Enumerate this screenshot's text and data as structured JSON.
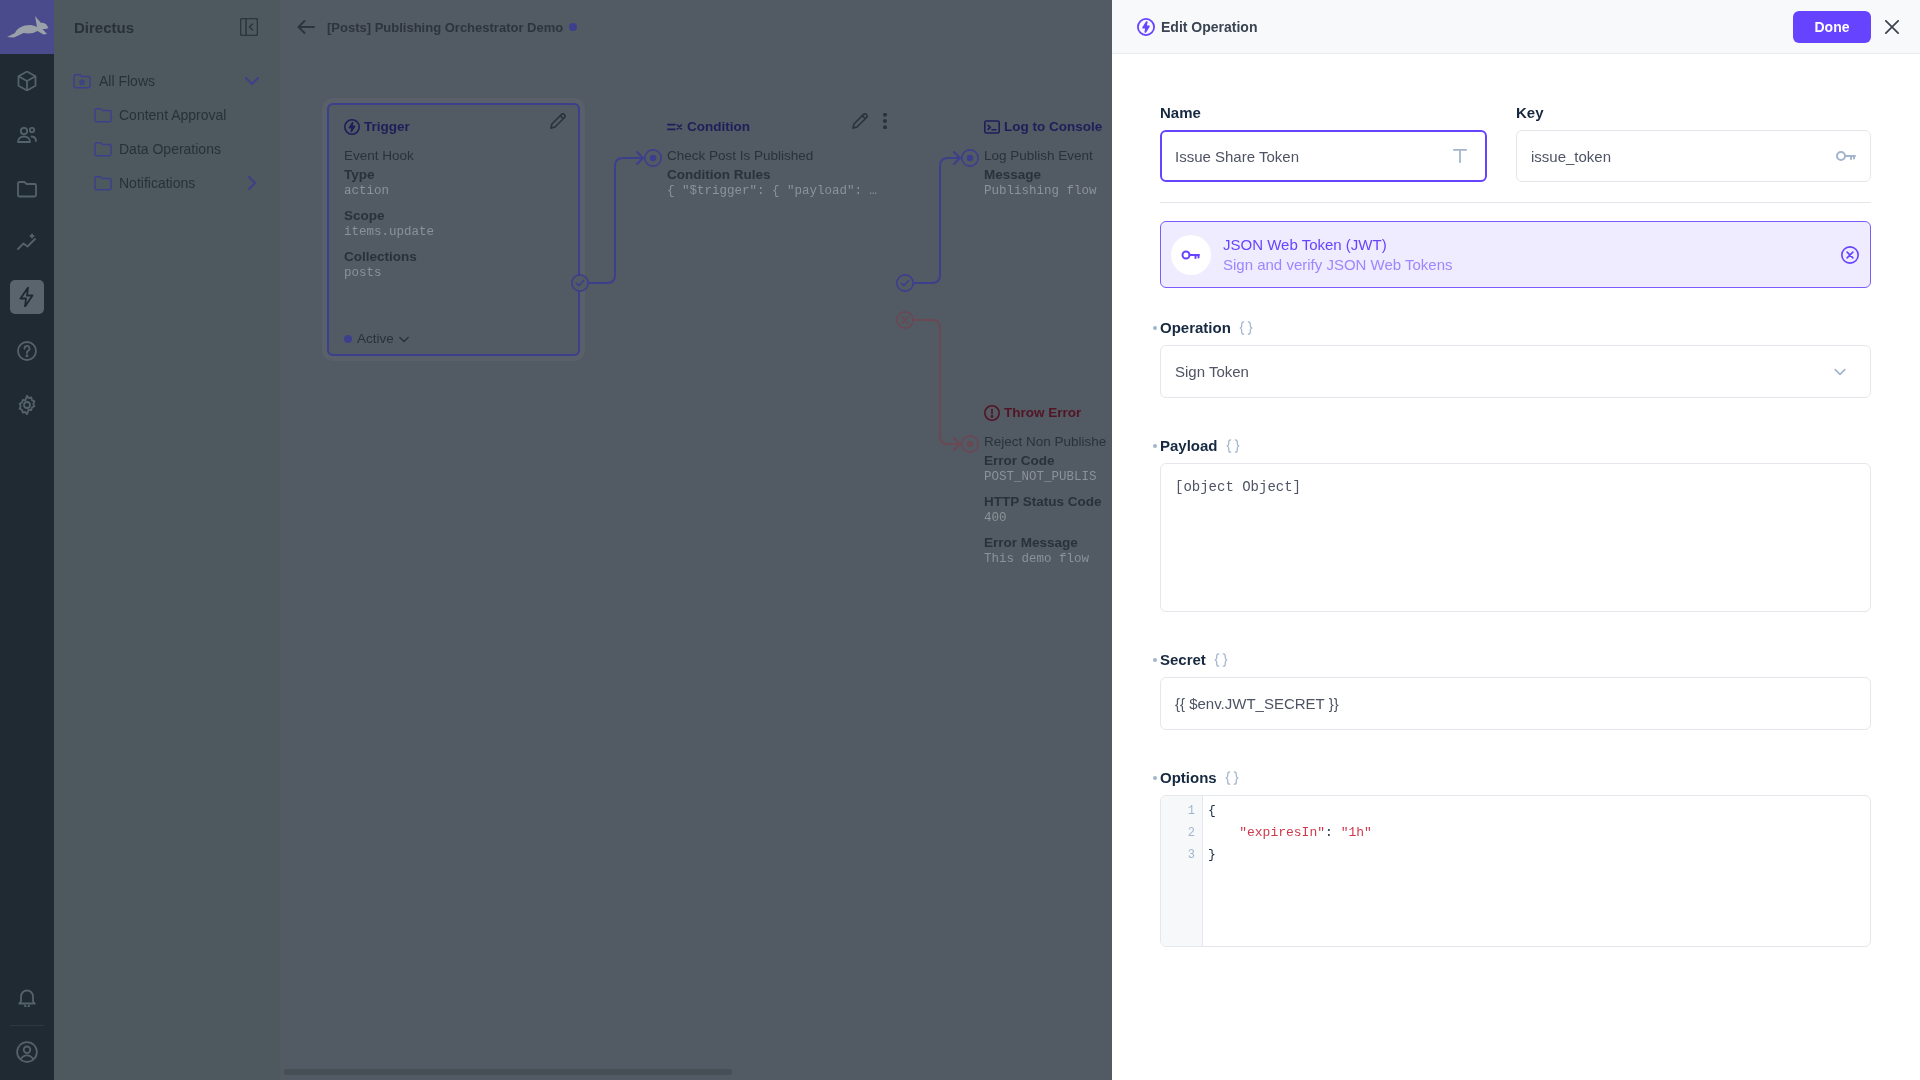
{
  "module_bar": {
    "modules": [
      {
        "selected": false
      },
      {
        "selected": false
      },
      {
        "selected": false
      },
      {
        "selected": false
      },
      {
        "selected": true
      },
      {
        "selected": false
      },
      {
        "selected": false
      }
    ]
  },
  "nav": {
    "title": "Directus",
    "tree": [
      {
        "label": "All Flows",
        "expanded": true,
        "children": [
          {
            "label": "Content Approval"
          },
          {
            "label": "Data Operations"
          },
          {
            "label": "Notifications",
            "expanded": false
          }
        ]
      }
    ]
  },
  "canvas": {
    "header": {
      "title": "[Posts] Publishing Orchestrator Demo",
      "unsaved": true
    },
    "panels": [
      {
        "kind": "trigger",
        "title": "Trigger",
        "tools": [
          {
            "kind": "edit"
          }
        ],
        "name": "Event Hook",
        "fields": [
          {
            "label": "Type",
            "value": "action"
          },
          {
            "label": "Scope",
            "value": "items.update"
          },
          {
            "label": "Collections",
            "value": "posts"
          }
        ],
        "status": {
          "label": "Active",
          "on": true
        },
        "resolve": true
      },
      {
        "kind": "condition",
        "title": "Condition",
        "tools": [
          {
            "kind": "edit"
          },
          {
            "kind": "more"
          }
        ],
        "name": "Check Post Is Published",
        "fields": [
          {
            "label": "Condition Rules",
            "value": "{ \"$trigger\": { \"payload\": …"
          }
        ],
        "resolve": true,
        "reject": true
      },
      {
        "kind": "log",
        "title": "Log to Console",
        "name": "Log Publish Event",
        "fields": [
          {
            "label": "Message",
            "value": "Publishing flow"
          }
        ]
      },
      {
        "kind": "exception",
        "title": "Throw Error",
        "name": "Reject Non Publishe",
        "fields": [
          {
            "label": "Error Code",
            "value": "POST_NOT_PUBLIS"
          },
          {
            "label": "HTTP Status Code",
            "value": "400"
          },
          {
            "label": "Error Message",
            "value": "This demo flow"
          }
        ]
      }
    ]
  },
  "drawer": {
    "title": "Edit Operation",
    "done_label": "Done",
    "header_fields": [
      {
        "kind": "text",
        "label": "Name",
        "value": "Issue Share Token",
        "focused": true
      },
      {
        "kind": "key",
        "label": "Key",
        "value": "issue_token",
        "focused": false
      }
    ],
    "operation_type": {
      "title": "JSON Web Token (JWT)",
      "description": "Sign and verify JSON Web Tokens"
    },
    "options": [
      {
        "kind": "select",
        "label": "Operation",
        "required": true,
        "value": "Sign Token"
      },
      {
        "kind": "textarea",
        "label": "Payload",
        "required": true,
        "value": "[object Object]"
      },
      {
        "kind": "input",
        "label": "Secret",
        "required": true,
        "value": "{{ $env.JWT_SECRET }}"
      },
      {
        "kind": "code",
        "label": "Options",
        "required": true,
        "lines": [
          {
            "number": "1",
            "tokens": [
              {
                "kind": "punctuation",
                "text": "{"
              }
            ]
          },
          {
            "number": "2",
            "tokens": [
              {
                "kind": "key",
                "text": "    \"expiresIn\""
              },
              {
                "kind": "punctuation",
                "text": ": "
              },
              {
                "kind": "string",
                "text": "\"1h\""
              }
            ]
          },
          {
            "number": "3",
            "tokens": [
              {
                "kind": "punctuation",
                "text": "}"
              }
            ]
          }
        ]
      }
    ]
  }
}
